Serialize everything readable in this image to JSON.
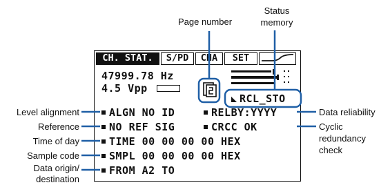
{
  "callouts": {
    "page_number": "Page number",
    "status_memory_line1": "Status",
    "status_memory_line2": "memory",
    "level_alignment": "Level alignment",
    "reference": "Reference",
    "time_of_day": "Time of day",
    "sample_code": "Sample code",
    "data_origin_line1": "Data origin/",
    "data_origin_line2": "destination",
    "data_reliability": "Data reliability",
    "crc_line1": "Cyclic",
    "crc_line2": "redundancy",
    "crc_line3": "check"
  },
  "display": {
    "tabs": [
      "CH. STAT.",
      "S/PD",
      "CHA",
      "SET"
    ],
    "frequency": "47999.78 Hz",
    "level": "4.5 Vpp",
    "status_memory": "RCL_STO",
    "rows": [
      {
        "left": "ALGN NO ID",
        "right": "RELBY:YYYY"
      },
      {
        "left": "NO REF SIG",
        "right": "CRCC OK"
      },
      {
        "left": "TIME 00 00 00 00 HEX",
        "right": ""
      },
      {
        "left": "SMPL 00 00 00 00 HEX",
        "right": ""
      },
      {
        "left": "FROM  A2  TO",
        "right": ""
      }
    ]
  },
  "colors": {
    "callout_line": "#1f5fa6",
    "lcd_ink": "#111111",
    "background": "#ffffff"
  }
}
